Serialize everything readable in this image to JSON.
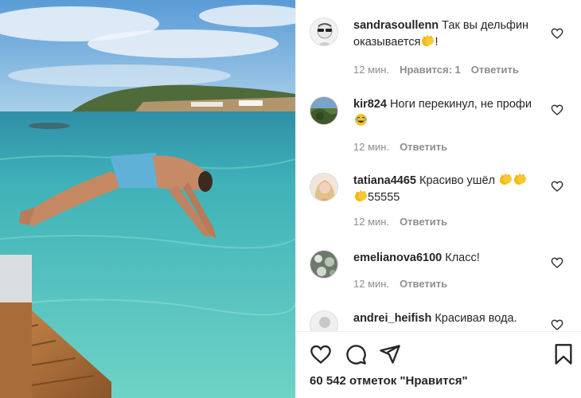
{
  "post": {
    "image": {
      "description_icon": "photo-of-man-diving-into-sea"
    }
  },
  "comments": [
    {
      "username": "sandrasoullenn",
      "text_before": "Так вы дельфин оказывается",
      "emoji": "clapping-hands-icon",
      "text_after": "!",
      "time": "12 мин.",
      "likes": "Нравится: 1",
      "reply": "Ответить",
      "avatar_icon": "sunglasses-avatar"
    },
    {
      "username": "kir824",
      "text_before": "Ноги перекинул, не профи",
      "emoji": "laughing-face-icon",
      "text_after": "",
      "time": "12 мин.",
      "reply": "Ответить",
      "avatar_icon": "landscape-avatar"
    },
    {
      "username": "tatiana4465",
      "text_before": "Красиво ушёл",
      "emoji": "clapping-hands-icon",
      "text_after": "55555",
      "time": "12 мин.",
      "reply": "Ответить",
      "avatar_icon": "woman-avatar"
    },
    {
      "username": "emelianova6100",
      "text_before": "Класс!",
      "emoji": "",
      "text_after": "",
      "time": "12 мин.",
      "reply": "Ответить",
      "avatar_icon": "flowers-avatar"
    },
    {
      "username": "andrei_heifish",
      "text_before": "Красивая вода.",
      "emoji": "",
      "text_after": "",
      "avatar_icon": "default-avatar"
    }
  ],
  "actions": {
    "like_icon": "heart-icon",
    "comment_icon": "comment-icon",
    "share_icon": "share-icon",
    "save_icon": "bookmark-icon"
  },
  "likes_text": "60 542 отметок \"Нравится\"",
  "colors": {
    "text": "#262626",
    "secondary": "#8e8e8e",
    "divider": "#efefef",
    "emoji_yellow": "#f5b914"
  }
}
